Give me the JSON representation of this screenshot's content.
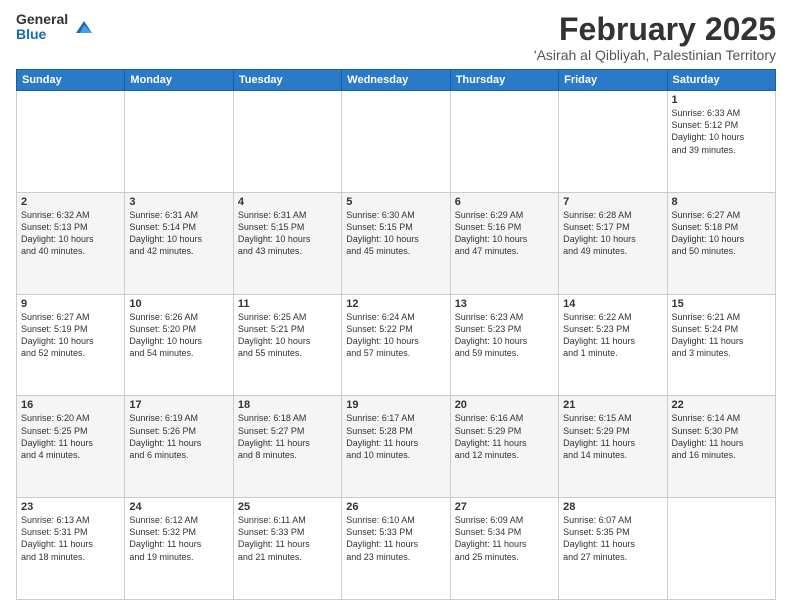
{
  "header": {
    "logo_general": "General",
    "logo_blue": "Blue",
    "month_title": "February 2025",
    "subtitle": "'Asirah al Qibliyah, Palestinian Territory"
  },
  "days_of_week": [
    "Sunday",
    "Monday",
    "Tuesday",
    "Wednesday",
    "Thursday",
    "Friday",
    "Saturday"
  ],
  "weeks": [
    [
      {
        "day": "",
        "info": ""
      },
      {
        "day": "",
        "info": ""
      },
      {
        "day": "",
        "info": ""
      },
      {
        "day": "",
        "info": ""
      },
      {
        "day": "",
        "info": ""
      },
      {
        "day": "",
        "info": ""
      },
      {
        "day": "1",
        "info": "Sunrise: 6:33 AM\nSunset: 5:12 PM\nDaylight: 10 hours\nand 39 minutes."
      }
    ],
    [
      {
        "day": "2",
        "info": "Sunrise: 6:32 AM\nSunset: 5:13 PM\nDaylight: 10 hours\nand 40 minutes."
      },
      {
        "day": "3",
        "info": "Sunrise: 6:31 AM\nSunset: 5:14 PM\nDaylight: 10 hours\nand 42 minutes."
      },
      {
        "day": "4",
        "info": "Sunrise: 6:31 AM\nSunset: 5:15 PM\nDaylight: 10 hours\nand 43 minutes."
      },
      {
        "day": "5",
        "info": "Sunrise: 6:30 AM\nSunset: 5:15 PM\nDaylight: 10 hours\nand 45 minutes."
      },
      {
        "day": "6",
        "info": "Sunrise: 6:29 AM\nSunset: 5:16 PM\nDaylight: 10 hours\nand 47 minutes."
      },
      {
        "day": "7",
        "info": "Sunrise: 6:28 AM\nSunset: 5:17 PM\nDaylight: 10 hours\nand 49 minutes."
      },
      {
        "day": "8",
        "info": "Sunrise: 6:27 AM\nSunset: 5:18 PM\nDaylight: 10 hours\nand 50 minutes."
      }
    ],
    [
      {
        "day": "9",
        "info": "Sunrise: 6:27 AM\nSunset: 5:19 PM\nDaylight: 10 hours\nand 52 minutes."
      },
      {
        "day": "10",
        "info": "Sunrise: 6:26 AM\nSunset: 5:20 PM\nDaylight: 10 hours\nand 54 minutes."
      },
      {
        "day": "11",
        "info": "Sunrise: 6:25 AM\nSunset: 5:21 PM\nDaylight: 10 hours\nand 55 minutes."
      },
      {
        "day": "12",
        "info": "Sunrise: 6:24 AM\nSunset: 5:22 PM\nDaylight: 10 hours\nand 57 minutes."
      },
      {
        "day": "13",
        "info": "Sunrise: 6:23 AM\nSunset: 5:23 PM\nDaylight: 10 hours\nand 59 minutes."
      },
      {
        "day": "14",
        "info": "Sunrise: 6:22 AM\nSunset: 5:23 PM\nDaylight: 11 hours\nand 1 minute."
      },
      {
        "day": "15",
        "info": "Sunrise: 6:21 AM\nSunset: 5:24 PM\nDaylight: 11 hours\nand 3 minutes."
      }
    ],
    [
      {
        "day": "16",
        "info": "Sunrise: 6:20 AM\nSunset: 5:25 PM\nDaylight: 11 hours\nand 4 minutes."
      },
      {
        "day": "17",
        "info": "Sunrise: 6:19 AM\nSunset: 5:26 PM\nDaylight: 11 hours\nand 6 minutes."
      },
      {
        "day": "18",
        "info": "Sunrise: 6:18 AM\nSunset: 5:27 PM\nDaylight: 11 hours\nand 8 minutes."
      },
      {
        "day": "19",
        "info": "Sunrise: 6:17 AM\nSunset: 5:28 PM\nDaylight: 11 hours\nand 10 minutes."
      },
      {
        "day": "20",
        "info": "Sunrise: 6:16 AM\nSunset: 5:29 PM\nDaylight: 11 hours\nand 12 minutes."
      },
      {
        "day": "21",
        "info": "Sunrise: 6:15 AM\nSunset: 5:29 PM\nDaylight: 11 hours\nand 14 minutes."
      },
      {
        "day": "22",
        "info": "Sunrise: 6:14 AM\nSunset: 5:30 PM\nDaylight: 11 hours\nand 16 minutes."
      }
    ],
    [
      {
        "day": "23",
        "info": "Sunrise: 6:13 AM\nSunset: 5:31 PM\nDaylight: 11 hours\nand 18 minutes."
      },
      {
        "day": "24",
        "info": "Sunrise: 6:12 AM\nSunset: 5:32 PM\nDaylight: 11 hours\nand 19 minutes."
      },
      {
        "day": "25",
        "info": "Sunrise: 6:11 AM\nSunset: 5:33 PM\nDaylight: 11 hours\nand 21 minutes."
      },
      {
        "day": "26",
        "info": "Sunrise: 6:10 AM\nSunset: 5:33 PM\nDaylight: 11 hours\nand 23 minutes."
      },
      {
        "day": "27",
        "info": "Sunrise: 6:09 AM\nSunset: 5:34 PM\nDaylight: 11 hours\nand 25 minutes."
      },
      {
        "day": "28",
        "info": "Sunrise: 6:07 AM\nSunset: 5:35 PM\nDaylight: 11 hours\nand 27 minutes."
      },
      {
        "day": "",
        "info": ""
      }
    ]
  ]
}
